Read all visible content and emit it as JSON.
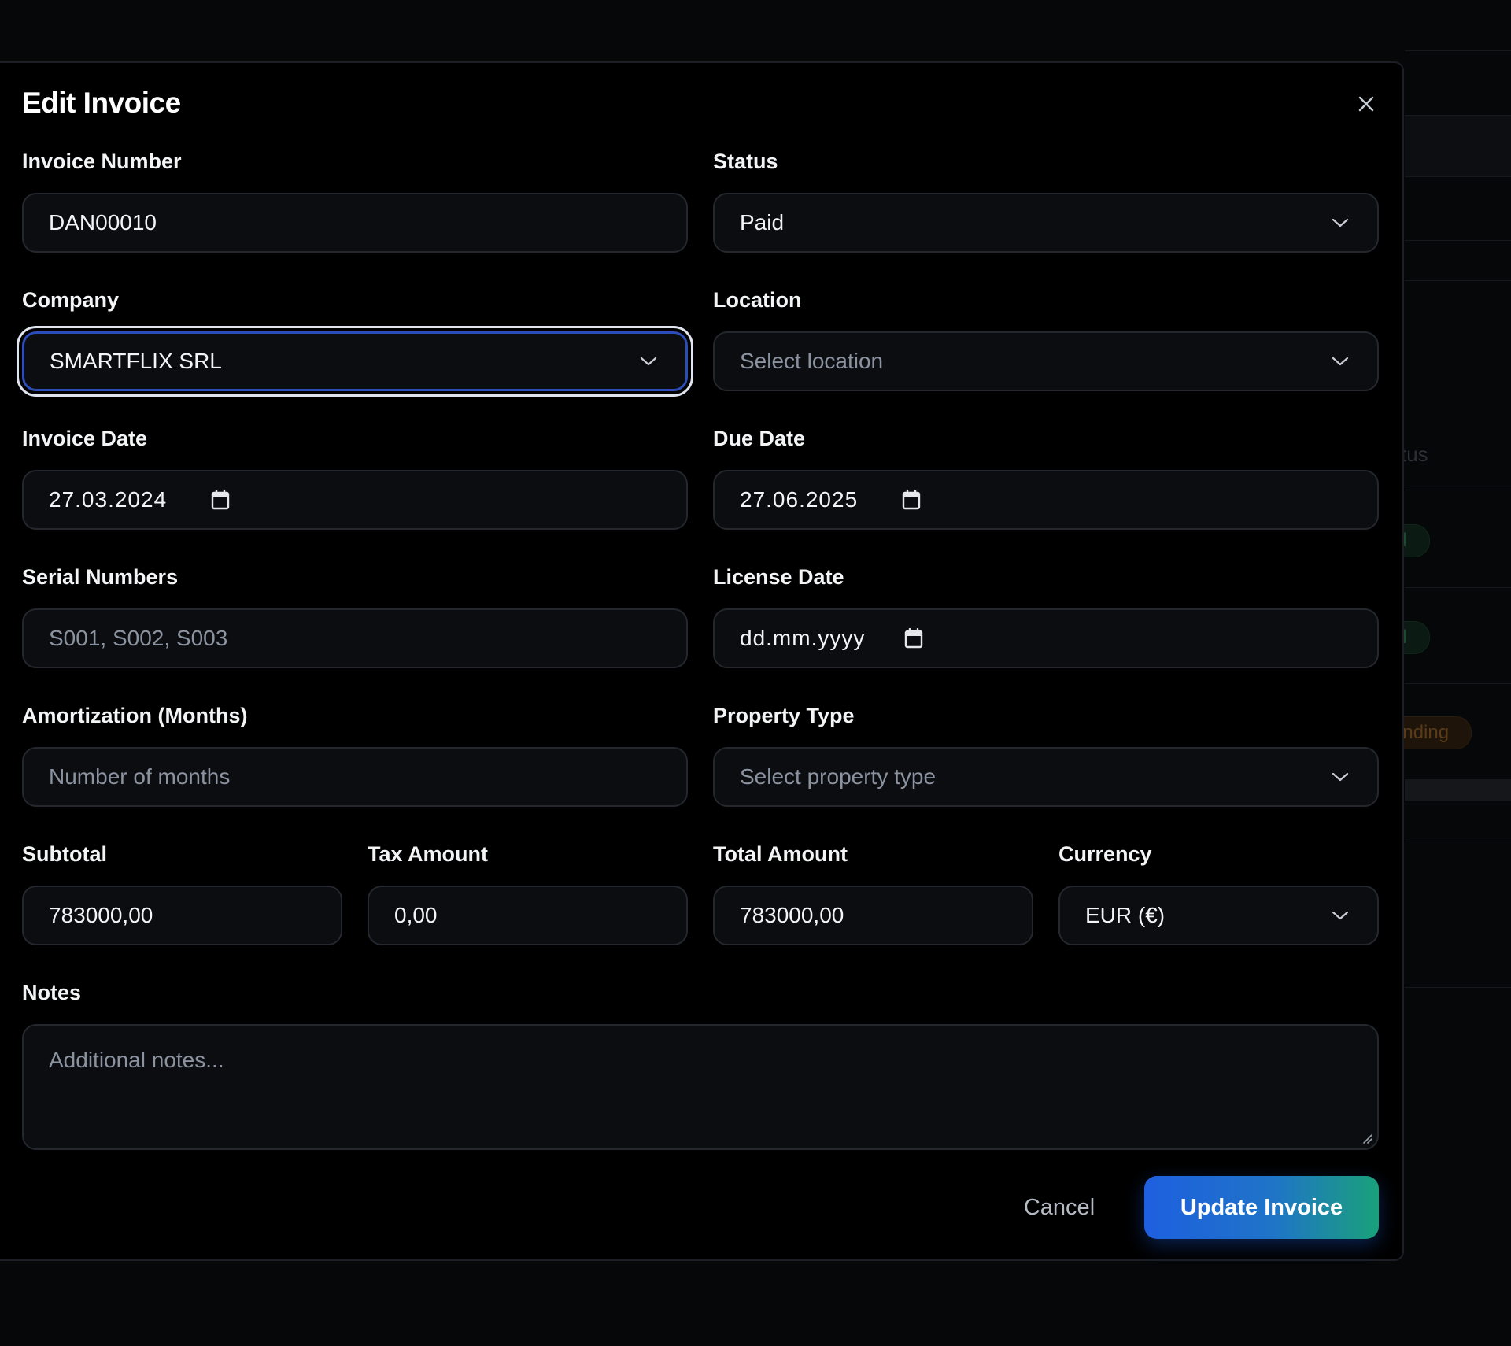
{
  "background": {
    "column_header": "tus",
    "status_pills": [
      "id",
      "id",
      "ending"
    ]
  },
  "modal": {
    "title": "Edit Invoice",
    "close_icon": "close-icon"
  },
  "fields": {
    "invoice_number": {
      "label": "Invoice Number",
      "value": "DAN00010"
    },
    "status": {
      "label": "Status",
      "value": "Paid"
    },
    "company": {
      "label": "Company",
      "value": "SMARTFLIX SRL"
    },
    "location": {
      "label": "Location",
      "placeholder": "Select location"
    },
    "invoice_date": {
      "label": "Invoice Date",
      "value": "27.03.2024"
    },
    "due_date": {
      "label": "Due Date",
      "value": "27.06.2025"
    },
    "serial_numbers": {
      "label": "Serial Numbers",
      "placeholder": "S001, S002, S003"
    },
    "license_date": {
      "label": "License Date",
      "value": "dd.mm.yyyy"
    },
    "amortization": {
      "label": "Amortization (Months)",
      "placeholder": "Number of months"
    },
    "property_type": {
      "label": "Property Type",
      "placeholder": "Select property type"
    },
    "subtotal": {
      "label": "Subtotal",
      "value": "783000,00"
    },
    "tax_amount": {
      "label": "Tax Amount",
      "value": "0,00"
    },
    "total_amount": {
      "label": "Total Amount",
      "value": "783000,00"
    },
    "currency": {
      "label": "Currency",
      "value": "EUR (€)"
    },
    "notes": {
      "label": "Notes",
      "placeholder": "Additional notes..."
    }
  },
  "actions": {
    "cancel_label": "Cancel",
    "update_label": "Update Invoice"
  },
  "colors": {
    "accent_start": "#1e5fe0",
    "accent_end": "#1aa17a",
    "focus_ring": "#2b4db8"
  }
}
